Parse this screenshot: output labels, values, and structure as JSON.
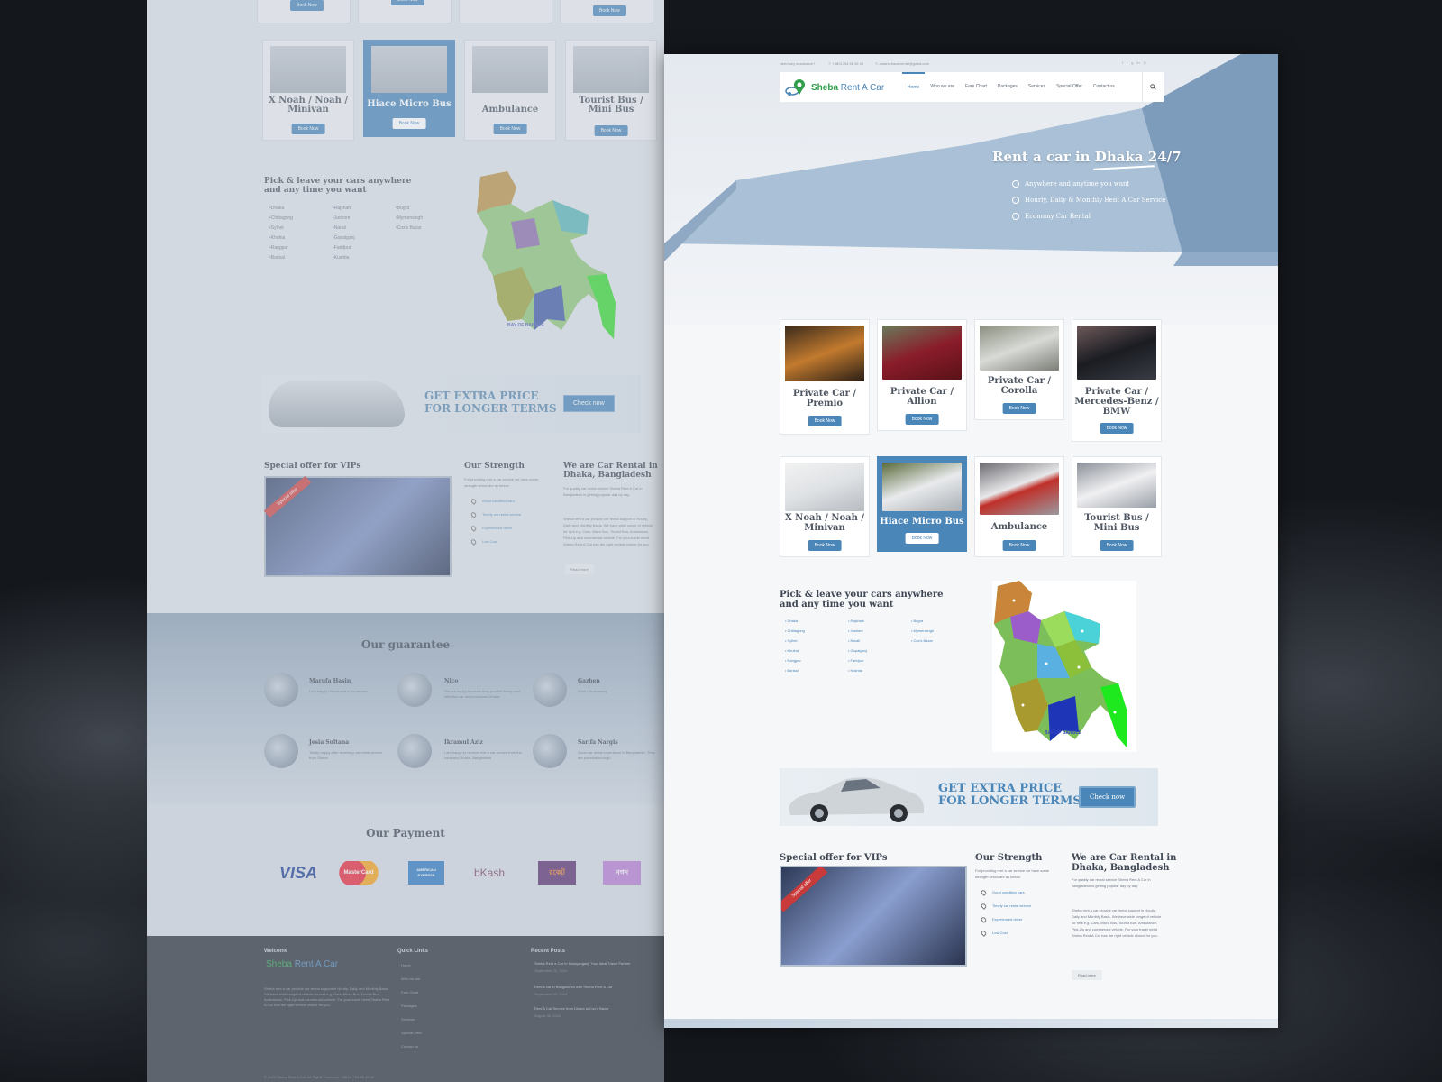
{
  "colors": {
    "accent": "#4a86b8",
    "brand_green": "#2e9e4a",
    "text": "#4d5560",
    "background": "#15181d"
  },
  "topbar": {
    "intro": "Need any assistance?",
    "phone": "+8801754 88 45 45",
    "email": "amarsebacarrental@gmail.com",
    "social_icons": [
      "facebook-icon",
      "twitter-icon",
      "googleplus-icon",
      "linkedin-icon",
      "rss-icon"
    ]
  },
  "brand": {
    "name": "Sheba",
    "suffix": "Rent A Car"
  },
  "nav": {
    "items": [
      "Home",
      "Who we are",
      "Fare Chart",
      "Packages",
      "Services",
      "Special Offer",
      "Contact us"
    ],
    "active_index": 0
  },
  "hero": {
    "title": "Rent a car in Dhaka 24/7",
    "features": [
      {
        "icon": "map-pin-icon",
        "text": "Anywhere and anytime you want"
      },
      {
        "icon": "clock-icon",
        "text": "Hourly, Daily & Monthly Rent A Car Service"
      },
      {
        "icon": "shield-icon",
        "text": "Economy Car Rental"
      }
    ]
  },
  "book_label": "Book Now",
  "vehicles": [
    {
      "title": "Private Car / Premio"
    },
    {
      "title": "Private Car / Allion"
    },
    {
      "title": "Private Car / Corolla"
    },
    {
      "title": "Private Car / Mercedes-Benz / BMW"
    },
    {
      "title": "X Noah / Noah / Minivan"
    },
    {
      "title": "Hiace Micro Bus"
    },
    {
      "title": "Ambulance"
    },
    {
      "title": "Tourist Bus / Mini Bus"
    }
  ],
  "locations_section": {
    "title_line1": "Pick & leave your cars anywhere",
    "title_line2": "and any time you want",
    "col1": [
      "Dhaka",
      "Chittagong",
      "Sylhet",
      "Khulna",
      "Rangpur",
      "Barisal"
    ],
    "col2": [
      "Rajshahi",
      "Jashore",
      "Narail",
      "Gopalganj",
      "Faridpur",
      "Kushtia"
    ],
    "col3": [
      "Bogra",
      "Mymensingh",
      "Cox's Bazar"
    ],
    "map_caption": "BAY OF BANGLE"
  },
  "promo": {
    "line1": "GET EXTRA PRICE",
    "line2": "FOR LONGER TERMS",
    "button": "Check now"
  },
  "vip": {
    "title": "Special offer for VIPs",
    "ribbon": "Special offer"
  },
  "strength": {
    "title": "Our Strength",
    "intro": "For providing rent a car service we have some strength which are as below.",
    "items": [
      "Good condition cars",
      "Timely car rental service",
      "Experienced driver",
      "Low Cost"
    ]
  },
  "about": {
    "title_line1": "We are Car Rental in",
    "title_line2": "Dhaka, Bangladesh",
    "para1": "For quality car rental service Sheba Rent A Car in Bangladesh is getting popular day by day.",
    "para2": "Sheba rent a car provide car rental support in Hourly, Daily and Monthly Basis. We have wide range of vehicle for rent e.g. Cars, Micro Bus, Tourist Bus, Ambulance, Pick-Up and commercial vehicle. For your travel need Sheba Rent A Car has the right vehicle choice for you.",
    "read_more": "Read more"
  },
  "guarantee": {
    "title": "Our guarantee",
    "testimonials": [
      {
        "name": "Marufa Hasin",
        "text": "I am happy i found rent a car service"
      },
      {
        "name": "Nico",
        "text": "We are happy because they provide timely cost-effective car rental services Dhaka."
      },
      {
        "name": "Gazben",
        "text": "Wow ! its amazing"
      },
      {
        "name": "Jesia Sultana",
        "text": "Totally happy after receiving car rental service from Sheba"
      },
      {
        "name": "Ikramul Aziz",
        "text": "I am happy to receive rent a car service from the company Dhaka, Bangladesh"
      },
      {
        "name": "Sarifa Nargis",
        "text": "Good car rental experience in Bangladesh. They are punctual enough."
      }
    ]
  },
  "payment": {
    "title": "Our Payment",
    "methods": [
      "VISA",
      "MasterCard",
      "AMERICAN EXPRESS",
      "bKash",
      "রকেট",
      "নগদ"
    ]
  },
  "footer": {
    "welcome_title": "Welcome",
    "welcome_text": "Sheba rent a car provide car rental support in Hourly, Daily and Monthly Basis. We have wide range of vehicle for rent e.g. Cars, Micro Bus, Tourist Bus, Ambulance, Pick-Up and commercial vehicle. For your travel need Sheba Rent A Car has the right vehicle choice for you.",
    "quick_links_title": "Quick Links",
    "quick_links": [
      "Home",
      "Who we are",
      "Fare Chart",
      "Packages",
      "Services",
      "Special Offer",
      "Contact us"
    ],
    "recent_title": "Recent Posts",
    "posts": [
      {
        "title": "Sheba Rent a Car In Narayanganj: Your Ideal Travel Partner",
        "date": "September 22, 2024"
      },
      {
        "title": "Rent a car in Bangladesh with Sheba Rent a Car",
        "date": "September 03, 2024"
      },
      {
        "title": "Rent A Car Service from Dhaka to Cox's Bazar",
        "date": "August 30, 2024"
      }
    ],
    "copyright": "© 2024 Sheba Rent A Car. All Rights Reserved. +88 01 754 88 45 45"
  }
}
